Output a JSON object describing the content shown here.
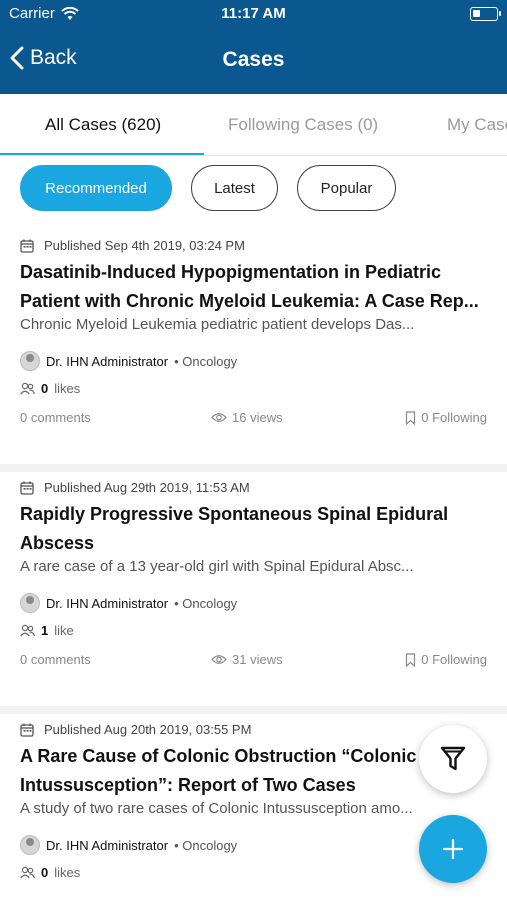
{
  "status_bar": {
    "carrier": "Carrier",
    "time": "11:17 AM"
  },
  "nav": {
    "back_label": "Back",
    "title": "Cases"
  },
  "tabs": [
    {
      "label": "All Cases (620)",
      "active": true
    },
    {
      "label": "Following Cases (0)",
      "active": false
    },
    {
      "label": "My Cases",
      "active": false
    }
  ],
  "filters": [
    {
      "label": "Recommended",
      "active": true
    },
    {
      "label": "Latest",
      "active": false
    },
    {
      "label": "Popular",
      "active": false
    }
  ],
  "cases": [
    {
      "published": "Published Sep 4th 2019, 03:24 PM",
      "title": "Dasatinib-Induced Hypopigmentation in Pediatric Patient with Chronic Myeloid Leukemia: A Case Rep...",
      "summary": "Chronic Myeloid Leukemia pediatric patient develops Das...",
      "author": "Dr. IHN Administrator",
      "specialty": "• Oncology",
      "likes_count": "0",
      "likes_label": "likes",
      "comments": "0 comments",
      "views": "16 views",
      "following": "0 Following"
    },
    {
      "published": "Published Aug 29th 2019, 11:53 AM",
      "title": "Rapidly Progressive Spontaneous Spinal Epidural Abscess",
      "summary": "A rare case of a 13 year-old girl with Spinal Epidural Absc...",
      "author": "Dr. IHN Administrator",
      "specialty": "• Oncology",
      "likes_count": "1",
      "likes_label": "like",
      "comments": "0 comments",
      "views": "31 views",
      "following": "0 Following"
    },
    {
      "published": "Published Aug 20th 2019, 03:55 PM",
      "title": "A Rare Cause of Colonic Obstruction “Colonic Intussusception”: Report of Two Cases",
      "summary": "A study of two rare cases of Colonic Intussusception amo...",
      "author": "Dr. IHN Administrator",
      "specialty": "• Oncology",
      "likes_count": "0",
      "likes_label": "likes",
      "comments": "",
      "views": "",
      "following": ""
    }
  ],
  "colors": {
    "header": "#0b5890",
    "accent": "#1aa7e0"
  },
  "icons": {
    "filter_fab": "funnel-icon",
    "add_fab": "plus-icon"
  }
}
